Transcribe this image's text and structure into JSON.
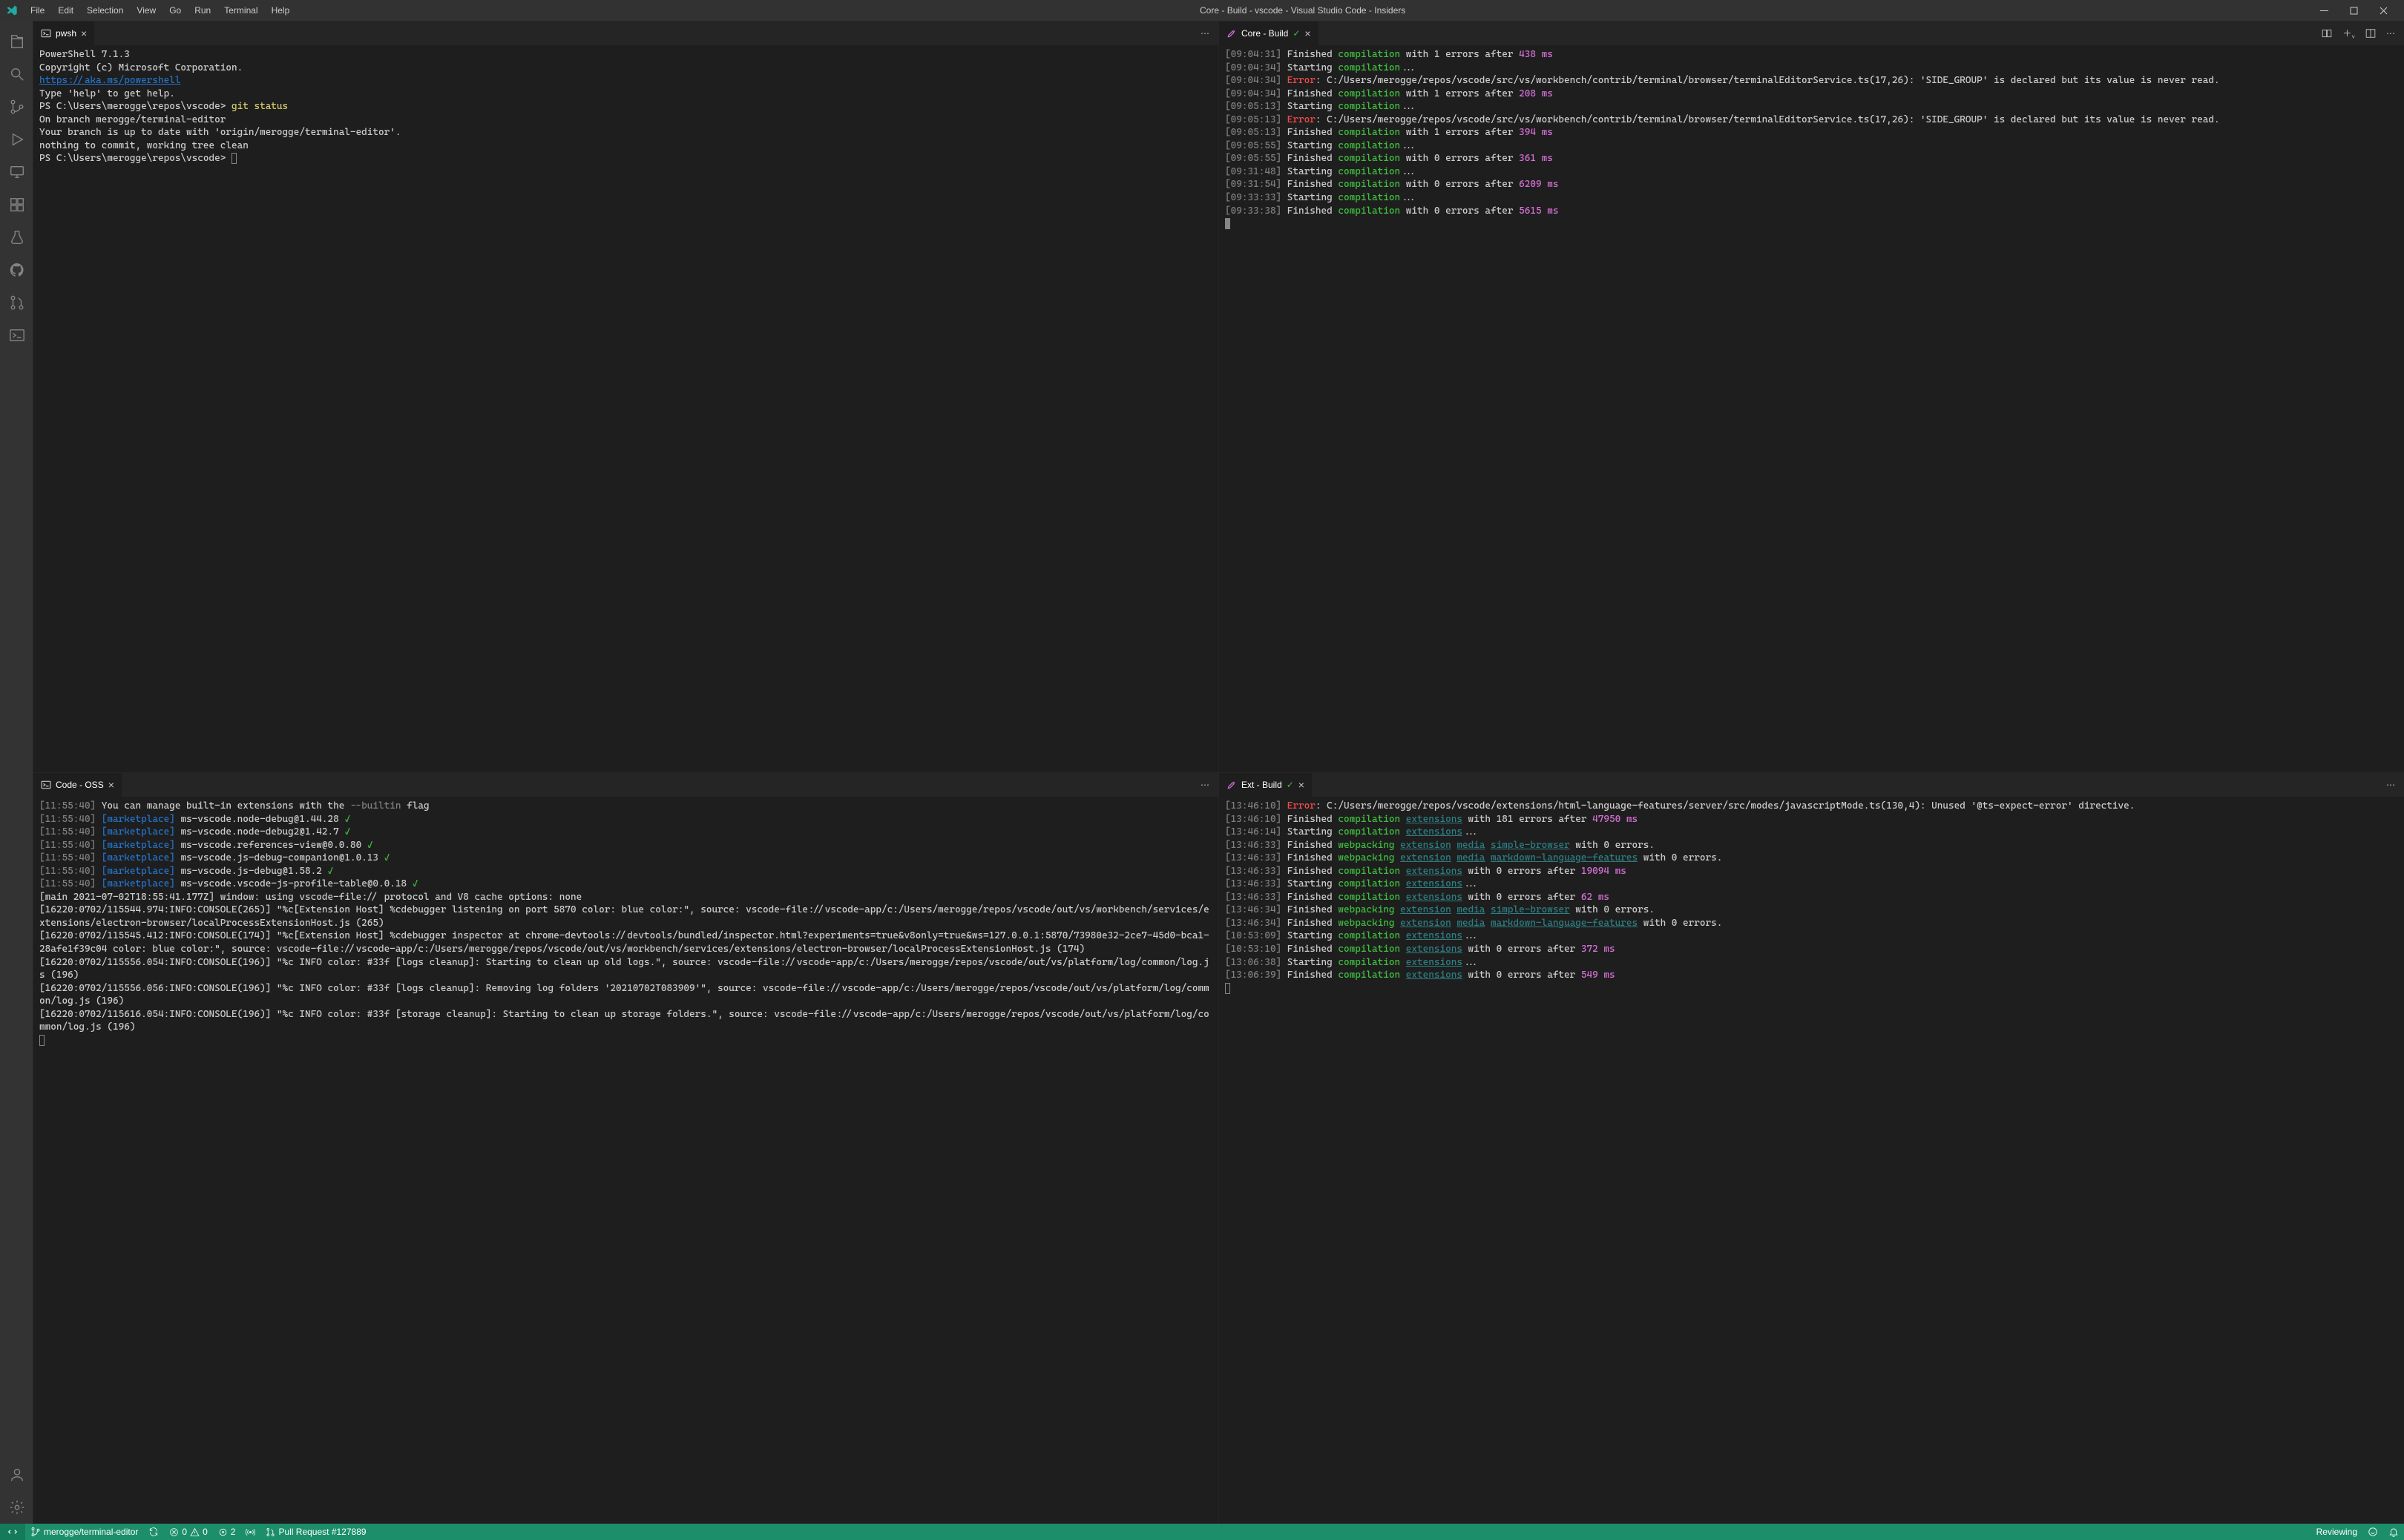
{
  "title": "Core - Build - vscode - Visual Studio Code - Insiders",
  "menu": [
    "File",
    "Edit",
    "Selection",
    "View",
    "Go",
    "Run",
    "Terminal",
    "Help"
  ],
  "tabs": {
    "tl": {
      "label": "pwsh"
    },
    "tr": {
      "label": "Core - Build"
    },
    "bl": {
      "label": "Code - OSS"
    },
    "br": {
      "label": "Ext - Build"
    }
  },
  "tl_lines": [
    [
      [
        "",
        "PowerShell 7.1.3"
      ]
    ],
    [
      [
        "",
        "Copyright (c) Microsoft Corporation."
      ]
    ],
    [
      [
        "",
        ""
      ]
    ],
    [
      [
        "link",
        "https://aka.ms/powershell"
      ]
    ],
    [
      [
        "",
        "Type 'help' to get help."
      ]
    ],
    [
      [
        "",
        ""
      ]
    ],
    [
      [
        "",
        "PS C:\\Users\\merogge\\repos\\vscode> "
      ],
      [
        "cmd",
        "git status"
      ]
    ],
    [
      [
        "",
        "On branch merogge/terminal-editor"
      ]
    ],
    [
      [
        "",
        "Your branch is up to date with 'origin/merogge/terminal-editor'."
      ]
    ],
    [
      [
        "",
        ""
      ]
    ],
    [
      [
        "",
        "nothing to commit, working tree clean"
      ]
    ],
    [
      [
        "",
        "PS C:\\Users\\merogge\\repos\\vscode> "
      ],
      [
        "cursor-outline",
        ""
      ]
    ]
  ],
  "tr_lines": [
    [
      [
        "ts",
        "[09:04:31]"
      ],
      [
        "",
        " Finished "
      ],
      [
        "kw",
        "compilation"
      ],
      [
        "",
        " with 1 errors after "
      ],
      [
        "num",
        "438 ms"
      ]
    ],
    [
      [
        "ts",
        "[09:04:34]"
      ],
      [
        "",
        " Starting "
      ],
      [
        "kw",
        "compilation"
      ],
      [
        "",
        "..."
      ]
    ],
    [
      [
        "ts",
        "[09:04:34]"
      ],
      [
        "",
        " "
      ],
      [
        "err",
        "Error"
      ],
      [
        "",
        ": C:/Users/merogge/repos/vscode/src/vs/workbench/contrib/terminal/browser/terminalEditorService.ts(17,26): 'SIDE_GROUP' is declared but its value is never read."
      ]
    ],
    [
      [
        "ts",
        "[09:04:34]"
      ],
      [
        "",
        " Finished "
      ],
      [
        "kw",
        "compilation"
      ],
      [
        "",
        " with 1 errors after "
      ],
      [
        "num",
        "208 ms"
      ]
    ],
    [
      [
        "ts",
        "[09:05:13]"
      ],
      [
        "",
        " Starting "
      ],
      [
        "kw",
        "compilation"
      ],
      [
        "",
        "..."
      ]
    ],
    [
      [
        "ts",
        "[09:05:13]"
      ],
      [
        "",
        " "
      ],
      [
        "err",
        "Error"
      ],
      [
        "",
        ": C:/Users/merogge/repos/vscode/src/vs/workbench/contrib/terminal/browser/terminalEditorService.ts(17,26): 'SIDE_GROUP' is declared but its value is never read."
      ]
    ],
    [
      [
        "ts",
        "[09:05:13]"
      ],
      [
        "",
        " Finished "
      ],
      [
        "kw",
        "compilation"
      ],
      [
        "",
        " with 1 errors after "
      ],
      [
        "num",
        "394 ms"
      ]
    ],
    [
      [
        "ts",
        "[09:05:55]"
      ],
      [
        "",
        " Starting "
      ],
      [
        "kw",
        "compilation"
      ],
      [
        "",
        "..."
      ]
    ],
    [
      [
        "ts",
        "[09:05:55]"
      ],
      [
        "",
        " Finished "
      ],
      [
        "kw",
        "compilation"
      ],
      [
        "",
        " with 0 errors after "
      ],
      [
        "num",
        "361 ms"
      ]
    ],
    [
      [
        "ts",
        "[09:31:48]"
      ],
      [
        "",
        " Starting "
      ],
      [
        "kw",
        "compilation"
      ],
      [
        "",
        "..."
      ]
    ],
    [
      [
        "ts",
        "[09:31:54]"
      ],
      [
        "",
        " Finished "
      ],
      [
        "kw",
        "compilation"
      ],
      [
        "",
        " with 0 errors after "
      ],
      [
        "num",
        "6209 ms"
      ]
    ],
    [
      [
        "ts",
        "[09:33:33]"
      ],
      [
        "",
        " Starting "
      ],
      [
        "kw",
        "compilation"
      ],
      [
        "",
        "..."
      ]
    ],
    [
      [
        "ts",
        "[09:33:38]"
      ],
      [
        "",
        " Finished "
      ],
      [
        "kw",
        "compilation"
      ],
      [
        "",
        " with 0 errors after "
      ],
      [
        "num",
        "5615 ms"
      ]
    ],
    [
      [
        "cursor",
        ""
      ]
    ]
  ],
  "bl_lines": [
    [
      [
        "ts",
        "[11:55:40]"
      ],
      [
        "",
        " You can manage built-in extensions with the "
      ],
      [
        "flag",
        "--builtin"
      ],
      [
        "",
        " flag"
      ]
    ],
    [
      [
        "ts",
        "[11:55:40]"
      ],
      [
        "",
        " "
      ],
      [
        "mp",
        "[marketplace]"
      ],
      [
        "",
        " ms-vscode.node-debug@1.44.28 "
      ],
      [
        "chk",
        "✓"
      ]
    ],
    [
      [
        "ts",
        "[11:55:40]"
      ],
      [
        "",
        " "
      ],
      [
        "mp",
        "[marketplace]"
      ],
      [
        "",
        " ms-vscode.node-debug2@1.42.7 "
      ],
      [
        "chk",
        "✓"
      ]
    ],
    [
      [
        "ts",
        "[11:55:40]"
      ],
      [
        "",
        " "
      ],
      [
        "mp",
        "[marketplace]"
      ],
      [
        "",
        " ms-vscode.references-view@0.0.80 "
      ],
      [
        "chk",
        "✓"
      ]
    ],
    [
      [
        "ts",
        "[11:55:40]"
      ],
      [
        "",
        " "
      ],
      [
        "mp",
        "[marketplace]"
      ],
      [
        "",
        " ms-vscode.js-debug-companion@1.0.13 "
      ],
      [
        "chk",
        "✓"
      ]
    ],
    [
      [
        "ts",
        "[11:55:40]"
      ],
      [
        "",
        " "
      ],
      [
        "mp",
        "[marketplace]"
      ],
      [
        "",
        " ms-vscode.js-debug@1.58.2 "
      ],
      [
        "chk",
        "✓"
      ]
    ],
    [
      [
        "ts",
        "[11:55:40]"
      ],
      [
        "",
        " "
      ],
      [
        "mp",
        "[marketplace]"
      ],
      [
        "",
        " ms-vscode.vscode-js-profile-table@0.0.18 "
      ],
      [
        "chk",
        "✓"
      ]
    ],
    [
      [
        "",
        ""
      ]
    ],
    [
      [
        "",
        "[main 2021-07-02T18:55:41.177Z] window: using vscode-file:// protocol and V8 cache options: none"
      ]
    ],
    [
      [
        "",
        "[16220:0702/115544.974:INFO:CONSOLE(265)] \"%c[Extension Host] %cdebugger listening on port 5870 color: blue color:\", source: vscode-file://vscode-app/c:/Users/merogge/repos/vscode/out/vs/workbench/services/extensions/electron-browser/localProcessExtensionHost.js (265)"
      ]
    ],
    [
      [
        "",
        "[16220:0702/115545.412:INFO:CONSOLE(174)] \"%c[Extension Host] %cdebugger inspector at chrome-devtools://devtools/bundled/inspector.html?experiments=true&v8only=true&ws=127.0.0.1:5870/73980e32-2ce7-45d0-bca1-28afe1f39c04 color: blue color:\", source: vscode-file://vscode-app/c:/Users/merogge/repos/vscode/out/vs/workbench/services/extensions/electron-browser/localProcessExtensionHost.js (174)"
      ]
    ],
    [
      [
        "",
        "[16220:0702/115556.054:INFO:CONSOLE(196)] \"%c INFO color: #33f [logs cleanup]: Starting to clean up old logs.\", source: vscode-file://vscode-app/c:/Users/merogge/repos/vscode/out/vs/platform/log/common/log.js (196)"
      ]
    ],
    [
      [
        "",
        "[16220:0702/115556.056:INFO:CONSOLE(196)] \"%c INFO color: #33f [logs cleanup]: Removing log folders '20210702T083909'\", source: vscode-file://vscode-app/c:/Users/merogge/repos/vscode/out/vs/platform/log/common/log.js (196)"
      ]
    ],
    [
      [
        "",
        "[16220:0702/115616.054:INFO:CONSOLE(196)] \"%c INFO color: #33f [storage cleanup]: Starting to clean up storage folders.\", source: vscode-file://vscode-app/c:/Users/merogge/repos/vscode/out/vs/platform/log/common/log.js (196)"
      ]
    ],
    [
      [
        "cursor-outline",
        ""
      ]
    ]
  ],
  "br_lines": [
    [
      [
        "ts",
        "[13:46:10]"
      ],
      [
        "",
        " "
      ],
      [
        "err",
        "Error"
      ],
      [
        "",
        ": C:/Users/merogge/repos/vscode/extensions/html-language-features/server/src/modes/javascriptMode.ts(130,4): Unused '@ts-expect-error' directive."
      ]
    ],
    [
      [
        "ts",
        "[13:46:10]"
      ],
      [
        "",
        " Finished "
      ],
      [
        "kw",
        "compilation"
      ],
      [
        "",
        " "
      ],
      [
        "linkc",
        "extensions"
      ],
      [
        "",
        " with 181 errors after "
      ],
      [
        "num",
        "47950 ms"
      ]
    ],
    [
      [
        "ts",
        "[13:46:14]"
      ],
      [
        "",
        " Starting "
      ],
      [
        "kw",
        "compilation"
      ],
      [
        "",
        " "
      ],
      [
        "linkc",
        "extensions"
      ],
      [
        "",
        "..."
      ]
    ],
    [
      [
        "ts",
        "[13:46:33]"
      ],
      [
        "",
        " Finished "
      ],
      [
        "kw",
        "webpacking"
      ],
      [
        "",
        " "
      ],
      [
        "linkc",
        "extension"
      ],
      [
        "",
        " "
      ],
      [
        "linkc",
        "media"
      ],
      [
        "",
        " "
      ],
      [
        "linkc",
        "simple-browser"
      ],
      [
        "",
        " with 0 errors."
      ]
    ],
    [
      [
        "ts",
        "[13:46:33]"
      ],
      [
        "",
        " Finished "
      ],
      [
        "kw",
        "webpacking"
      ],
      [
        "",
        " "
      ],
      [
        "linkc",
        "extension"
      ],
      [
        "",
        " "
      ],
      [
        "linkc",
        "media"
      ],
      [
        "",
        " "
      ],
      [
        "linkc",
        "markdown-language-features"
      ],
      [
        "",
        " with 0 errors."
      ]
    ],
    [
      [
        "ts",
        "[13:46:33]"
      ],
      [
        "",
        " Finished "
      ],
      [
        "kw",
        "compilation"
      ],
      [
        "",
        " "
      ],
      [
        "linkc",
        "extensions"
      ],
      [
        "",
        " with 0 errors after "
      ],
      [
        "num",
        "19094 ms"
      ]
    ],
    [
      [
        "ts",
        "[13:46:33]"
      ],
      [
        "",
        " Starting "
      ],
      [
        "kw",
        "compilation"
      ],
      [
        "",
        " "
      ],
      [
        "linkc",
        "extensions"
      ],
      [
        "",
        "..."
      ]
    ],
    [
      [
        "ts",
        "[13:46:33]"
      ],
      [
        "",
        " Finished "
      ],
      [
        "kw",
        "compilation"
      ],
      [
        "",
        " "
      ],
      [
        "linkc",
        "extensions"
      ],
      [
        "",
        " with 0 errors after "
      ],
      [
        "num",
        "62 ms"
      ]
    ],
    [
      [
        "ts",
        "[13:46:34]"
      ],
      [
        "",
        " Finished "
      ],
      [
        "kw",
        "webpacking"
      ],
      [
        "",
        " "
      ],
      [
        "linkc",
        "extension"
      ],
      [
        "",
        " "
      ],
      [
        "linkc",
        "media"
      ],
      [
        "",
        " "
      ],
      [
        "linkc",
        "simple-browser"
      ],
      [
        "",
        " with 0 errors."
      ]
    ],
    [
      [
        "ts",
        "[13:46:34]"
      ],
      [
        "",
        " Finished "
      ],
      [
        "kw",
        "webpacking"
      ],
      [
        "",
        " "
      ],
      [
        "linkc",
        "extension"
      ],
      [
        "",
        " "
      ],
      [
        "linkc",
        "media"
      ],
      [
        "",
        " "
      ],
      [
        "linkc",
        "markdown-language-features"
      ],
      [
        "",
        " with 0 errors."
      ]
    ],
    [
      [
        "ts",
        "[10:53:09]"
      ],
      [
        "",
        " Starting "
      ],
      [
        "kw",
        "compilation"
      ],
      [
        "",
        " "
      ],
      [
        "linkc",
        "extensions"
      ],
      [
        "",
        "..."
      ]
    ],
    [
      [
        "ts",
        "[10:53:10]"
      ],
      [
        "",
        " Finished "
      ],
      [
        "kw",
        "compilation"
      ],
      [
        "",
        " "
      ],
      [
        "linkc",
        "extensions"
      ],
      [
        "",
        " with 0 errors after "
      ],
      [
        "num",
        "372 ms"
      ]
    ],
    [
      [
        "ts",
        "[13:06:38]"
      ],
      [
        "",
        " Starting "
      ],
      [
        "kw",
        "compilation"
      ],
      [
        "",
        " "
      ],
      [
        "linkc",
        "extensions"
      ],
      [
        "",
        "..."
      ]
    ],
    [
      [
        "ts",
        "[13:06:39]"
      ],
      [
        "",
        " Finished "
      ],
      [
        "kw",
        "compilation"
      ],
      [
        "",
        " "
      ],
      [
        "linkc",
        "extensions"
      ],
      [
        "",
        " with 0 errors after "
      ],
      [
        "num",
        "549 ms"
      ]
    ],
    [
      [
        "cursor-outline",
        ""
      ]
    ]
  ],
  "status": {
    "branch": "merogge/terminal-editor",
    "sync": "↻",
    "errors": "0",
    "warnings": "0",
    "ports": "2",
    "radio": "",
    "pr": "Pull Request #127889",
    "reviewing": "Reviewing"
  }
}
